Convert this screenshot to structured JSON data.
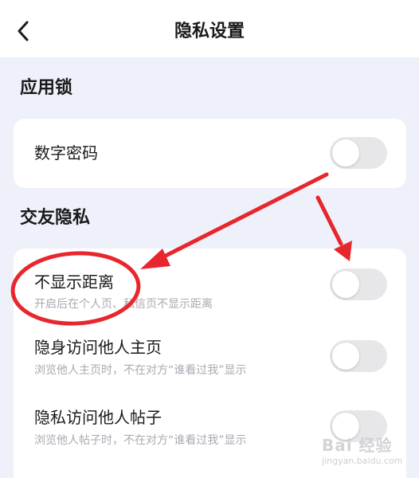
{
  "header": {
    "title": "隐私设置",
    "back_icon": "chevron-left-icon"
  },
  "sections": [
    {
      "title": "应用锁",
      "items": [
        {
          "label": "数字密码",
          "description": "",
          "enabled": false
        }
      ]
    },
    {
      "title": "交友隐私",
      "items": [
        {
          "label": "不显示距离",
          "description": "开启后在个人页、私信页不显示距离",
          "enabled": false
        },
        {
          "label": "隐身访问他人主页",
          "description": "浏览他人主页时，不在对方“谁看过我”显示",
          "enabled": false
        },
        {
          "label": "隐私访问他人帖子",
          "description": "浏览他人帖子时，不在对方“谁看过我”显示",
          "enabled": false
        }
      ]
    }
  ],
  "watermark": {
    "brand": "Bai 经验",
    "url": "jingyan.baidu.com"
  },
  "colors": {
    "page_background": "#eef0fa",
    "card_background": "#ffffff",
    "toggle_off": "#e7e7ea",
    "annotation_red": "#e8262e"
  }
}
